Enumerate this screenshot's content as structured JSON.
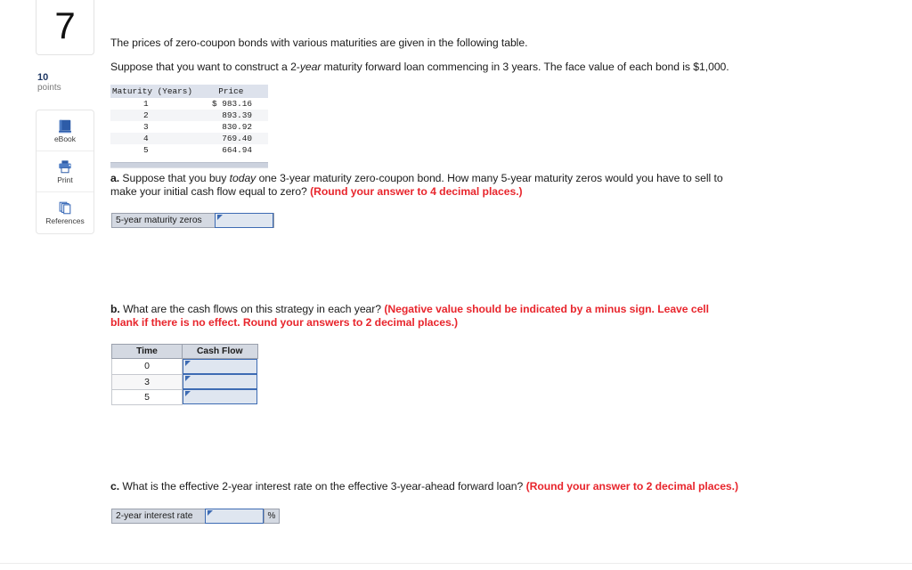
{
  "question": {
    "number": "7",
    "points_value": "10",
    "points_label": "points"
  },
  "tools": [
    {
      "icon": "book-icon",
      "label": "eBook"
    },
    {
      "icon": "printer-icon",
      "label": "Print"
    },
    {
      "icon": "copy-pages-icon",
      "label": "References"
    }
  ],
  "intro": {
    "line1": "The prices of zero-coupon bonds with various maturities are given in the following table.",
    "line2_pre": "Suppose that you want to construct a 2-",
    "line2_em": "year",
    "line2_post": " maturity forward loan commencing in 3 years. The face value of each bond is $1,000."
  },
  "bond_table": {
    "headers": [
      "Maturity (Years)",
      "Price"
    ],
    "rows": [
      {
        "maturity": "1",
        "price": "$ 983.16"
      },
      {
        "maturity": "2",
        "price": "893.39"
      },
      {
        "maturity": "3",
        "price": "830.92"
      },
      {
        "maturity": "4",
        "price": "769.40"
      },
      {
        "maturity": "5",
        "price": "664.94"
      }
    ]
  },
  "part_a": {
    "marker": "a.",
    "text_pre": " Suppose that you buy ",
    "text_em": "today",
    "text_post": " one 3-year maturity zero-coupon bond. How many 5-year maturity zeros would you have to sell to make your initial cash flow equal to zero? ",
    "requirement": "(Round your answer to 4 decimal places.)",
    "field_label": "5-year maturity zeros",
    "field_value": ""
  },
  "part_b": {
    "marker": "b.",
    "text": " What are the cash flows on this strategy in each year? ",
    "requirement": "(Negative value should be indicated by a minus sign. Leave cell blank if there is no effect. Round your answers to 2 decimal places.)",
    "table": {
      "headers": [
        "Time",
        "Cash Flow"
      ],
      "rows": [
        {
          "time": "0",
          "cash_flow": ""
        },
        {
          "time": "3",
          "cash_flow": ""
        },
        {
          "time": "5",
          "cash_flow": ""
        }
      ]
    }
  },
  "part_c": {
    "marker": "c.",
    "text": " What is the effective 2-year interest rate on the effective 3-year-ahead forward loan? ",
    "requirement": "(Round your answer to 2 decimal places.)",
    "field_label": "2-year interest rate",
    "field_value": "",
    "unit": "%"
  },
  "colors": {
    "requirement_red": "#e8262d",
    "points_blue": "#1f3864",
    "field_border_blue": "#3d6bb3",
    "field_fill": "#dfe6f0",
    "label_fill": "#d4d9e2",
    "table_header": "#dde2ec"
  }
}
